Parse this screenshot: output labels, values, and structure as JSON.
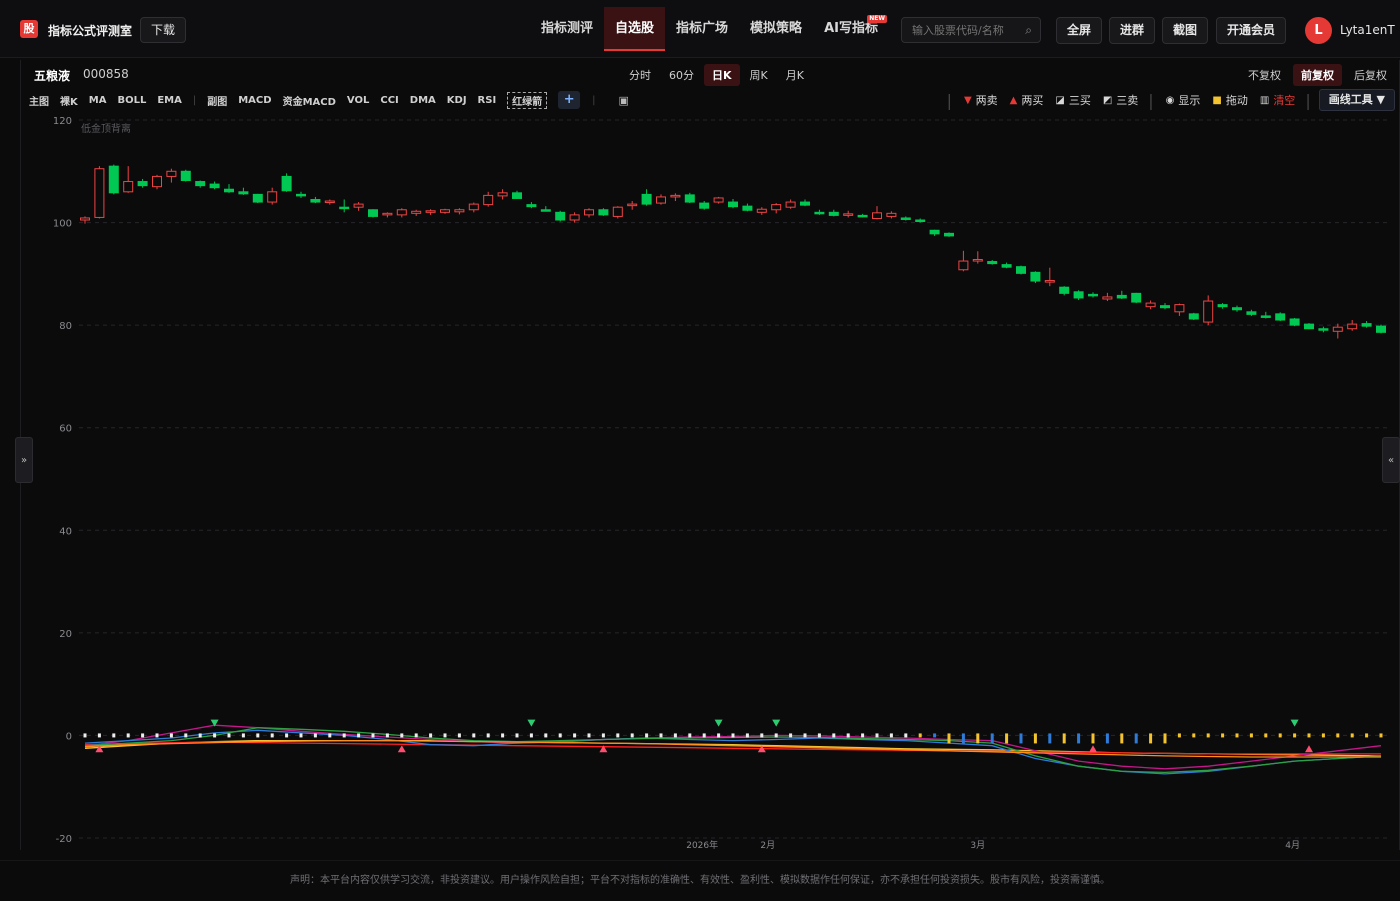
{
  "header": {
    "logo_char": "股",
    "brand": "指标公式评测室",
    "download": "下载",
    "nav": [
      {
        "label": "指标测评",
        "active": false
      },
      {
        "label": "自选股",
        "active": true
      },
      {
        "label": "指标广场",
        "active": false
      },
      {
        "label": "模拟策略",
        "active": false
      },
      {
        "label": "AI写指标",
        "active": false,
        "badge": "NEW"
      }
    ],
    "search_placeholder": "输入股票代码/名称",
    "buttons": [
      "全屏",
      "进群",
      "截图",
      "开通会员"
    ],
    "avatar_letter": "L",
    "username": "Lyta1enT"
  },
  "stock": {
    "name": "五粮液",
    "code": "000858"
  },
  "periods": [
    "分时",
    "60分",
    "日K",
    "周K",
    "月K"
  ],
  "active_period": "日K",
  "adjust": [
    "不复权",
    "前复权",
    "后复权"
  ],
  "active_adjust": "前复权",
  "indicators_main": [
    "主图",
    "裸K",
    "MA",
    "BOLL",
    "EMA"
  ],
  "indicators_sub": [
    "副图",
    "MACD",
    "资金MACD",
    "VOL",
    "CCI",
    "DMA",
    "KDJ",
    "RSI"
  ],
  "indicator_selected": "红绿箭",
  "tools": [
    {
      "icon": "down-triangle",
      "label": "两卖",
      "color": "#e53935"
    },
    {
      "icon": "up-triangle",
      "label": "两买",
      "color": "#e53935"
    },
    {
      "icon": "chart-icon",
      "label": "三买"
    },
    {
      "icon": "chart-icon",
      "label": "三卖"
    },
    {
      "icon": "eye-icon",
      "label": "显示"
    },
    {
      "icon": "lock-icon",
      "label": "拖动"
    },
    {
      "icon": "trash-icon",
      "label": "清空",
      "color": "#e53935"
    }
  ],
  "draw_tools": "画线工具 ▼",
  "expand_left": "»",
  "expand_right": "«",
  "chart_watermark": "低金顶背离",
  "footer": "声明：本平台内容仅供学习交流，非投资建议。用户操作风险自担；平台不对指标的准确性、有效性、盈利性、模拟数据作任何保证，亦不承担任何投资损失。股市有风险，投资需谨慎。",
  "chart_data": {
    "type": "candlestick",
    "y_ticks": [
      120,
      100,
      80,
      60,
      40,
      20,
      0,
      -20
    ],
    "ylim": [
      -20,
      120
    ],
    "x_labels": [
      "2026年",
      "2月",
      "3月",
      "4月"
    ],
    "candles": [
      [
        100.5,
        101.2,
        99.8,
        100.9
      ],
      [
        101,
        111,
        100.8,
        110.5
      ],
      [
        111,
        111.3,
        105.5,
        105.8
      ],
      [
        106,
        111,
        105.8,
        108
      ],
      [
        108,
        108.5,
        106.8,
        107.2
      ],
      [
        107,
        109.3,
        106.5,
        109
      ],
      [
        109,
        110.5,
        107.8,
        110
      ],
      [
        110,
        110.3,
        108,
        108.2
      ],
      [
        108,
        108.2,
        106.8,
        107.2
      ],
      [
        107.5,
        108,
        106.5,
        106.8
      ],
      [
        106.5,
        107.5,
        105.8,
        106
      ],
      [
        106,
        106.8,
        105.4,
        105.6
      ],
      [
        105.5,
        105.6,
        103.8,
        104
      ],
      [
        104,
        106.8,
        103.5,
        106
      ],
      [
        109,
        109.6,
        106,
        106.2
      ],
      [
        105.5,
        106,
        104.8,
        105.2
      ],
      [
        104.5,
        105,
        103.8,
        104
      ],
      [
        104,
        104.5,
        103.5,
        104.2
      ],
      [
        103,
        104.5,
        102,
        102.8
      ],
      [
        103,
        104,
        102.3,
        103.6
      ],
      [
        102.5,
        102.6,
        101,
        101.2
      ],
      [
        101.5,
        102,
        101,
        101.8
      ],
      [
        101.5,
        102.8,
        101,
        102.5
      ],
      [
        101.8,
        102.5,
        101.3,
        102.2
      ],
      [
        102,
        102.6,
        101.5,
        102.3
      ],
      [
        102,
        102.7,
        101.7,
        102.5
      ],
      [
        102.1,
        102.8,
        101.6,
        102.5
      ],
      [
        102.5,
        103.9,
        102,
        103.6
      ],
      [
        103.5,
        106,
        103.1,
        105.3
      ],
      [
        105.2,
        106.5,
        104.5,
        105.8
      ],
      [
        105.8,
        106.2,
        104.6,
        104.7
      ],
      [
        103.5,
        104,
        102.8,
        103.1
      ],
      [
        102.5,
        103.2,
        102.2,
        102.3
      ],
      [
        102,
        102.3,
        100.2,
        100.5
      ],
      [
        100.5,
        102,
        100,
        101.5
      ],
      [
        101.5,
        102.8,
        101,
        102.5
      ],
      [
        102.5,
        102.8,
        101.3,
        101.5
      ],
      [
        101.2,
        103.2,
        100.8,
        103
      ],
      [
        103.3,
        104.2,
        102.5,
        103.6
      ],
      [
        105.5,
        106.5,
        103.3,
        103.6
      ],
      [
        103.8,
        105.5,
        103.5,
        105
      ],
      [
        105,
        105.7,
        104.2,
        105.3
      ],
      [
        105.4,
        105.8,
        103.8,
        104
      ],
      [
        103.8,
        104.2,
        102.5,
        102.8
      ],
      [
        104,
        105,
        103.7,
        104.8
      ],
      [
        104,
        104.6,
        102.8,
        103.1
      ],
      [
        103.2,
        103.7,
        102.2,
        102.4
      ],
      [
        102,
        103,
        101.5,
        102.6
      ],
      [
        102.5,
        103.8,
        101.8,
        103.5
      ],
      [
        103,
        104.5,
        102.7,
        104
      ],
      [
        104,
        104.5,
        103.2,
        103.4
      ],
      [
        102,
        102.5,
        101.5,
        101.8
      ],
      [
        102,
        102.5,
        101.2,
        101.4
      ],
      [
        101.6,
        102.3,
        101,
        101.7
      ],
      [
        101.4,
        101.7,
        101,
        101.2
      ],
      [
        100.8,
        103.2,
        100.6,
        101.9
      ],
      [
        101.2,
        102.2,
        100.8,
        101.8
      ],
      [
        100.9,
        101.2,
        100.4,
        100.6
      ],
      [
        100.5,
        100.8,
        100,
        100.3
      ],
      [
        98.5,
        98.6,
        97.4,
        97.8
      ],
      [
        97.9,
        98.1,
        97.2,
        97.4
      ],
      [
        90.8,
        94.5,
        90.5,
        92.5
      ],
      [
        92.5,
        94.4,
        92,
        92.8
      ],
      [
        92.4,
        92.7,
        91.8,
        92
      ],
      [
        91.8,
        92.2,
        91.1,
        91.3
      ],
      [
        91.4,
        91.6,
        89.9,
        90.1
      ],
      [
        90.3,
        90.5,
        88.2,
        88.6
      ],
      [
        88.4,
        91.2,
        87.6,
        88.7
      ],
      [
        87.4,
        87.6,
        85.8,
        86.2
      ],
      [
        86.5,
        86.8,
        84.9,
        85.3
      ],
      [
        86,
        86.4,
        85.4,
        85.8
      ],
      [
        85.1,
        86.3,
        84.7,
        85.5
      ],
      [
        85.8,
        86.7,
        85.1,
        85.3
      ],
      [
        86.2,
        86.3,
        84.3,
        84.5
      ],
      [
        83.6,
        84.8,
        83.1,
        84.3
      ],
      [
        83.8,
        84.3,
        83.1,
        83.4
      ],
      [
        82.6,
        84.2,
        81.8,
        84
      ],
      [
        82.2,
        82.4,
        81,
        81.2
      ],
      [
        80.6,
        85.8,
        80,
        84.7
      ],
      [
        84,
        84.3,
        83.2,
        83.6
      ],
      [
        83.4,
        83.8,
        82.6,
        83
      ],
      [
        82.6,
        83,
        81.8,
        82.1
      ],
      [
        81.8,
        82.6,
        81.3,
        81.5
      ],
      [
        82.2,
        82.5,
        80.8,
        81
      ],
      [
        81.2,
        81.4,
        79.8,
        80
      ],
      [
        80.2,
        80.4,
        79.2,
        79.3
      ],
      [
        79.3,
        79.7,
        78.6,
        79.2
      ],
      [
        78.8,
        80.3,
        77.4,
        79.6
      ],
      [
        79.3,
        81,
        78.9,
        80.2
      ],
      [
        80.3,
        80.8,
        79.5,
        79.8
      ],
      [
        79.8,
        80.1,
        78.4,
        78.6
      ]
    ],
    "lines": [
      {
        "name": "line-yellow",
        "color": "#f4c430",
        "values": [
          -2.5,
          -2,
          -1.5,
          -1.2,
          -1,
          -1,
          -1,
          -1,
          -1,
          -1.2,
          -1.3,
          -1.4,
          -1.5,
          -1.6,
          -1.7,
          -1.8,
          -2,
          -2.2,
          -2.4,
          -2.6,
          -2.7,
          -2.8,
          -3,
          -3.2,
          -3.4,
          -3.5,
          -3.6,
          -3.7,
          -3.8,
          -3.9,
          -4
        ]
      },
      {
        "name": "line-red",
        "color": "#ff2020",
        "values": [
          -1.8,
          -1.6,
          -1.4,
          -1.3,
          -1.4,
          -1.5,
          -1.6,
          -1.7,
          -1.8,
          -1.9,
          -2,
          -2.1,
          -2.2,
          -2.3,
          -2.4,
          -2.5,
          -2.6,
          -2.7,
          -2.8,
          -2.9,
          -3,
          -3.1,
          -3.2,
          -3.3,
          -3.4,
          -3.5,
          -3.6,
          -3.6,
          -3.6,
          -3.6,
          -3.6
        ]
      },
      {
        "name": "line-magenta",
        "color": "#c2188a",
        "values": [
          -2,
          -1,
          0.5,
          2,
          1.5,
          0.8,
          0.2,
          -0.3,
          -0.8,
          -1.2,
          -1.5,
          -1.3,
          -0.8,
          -0.5,
          -0.3,
          -0.2,
          0,
          -0.1,
          -0.3,
          -0.5,
          -0.8,
          -1,
          -3,
          -5,
          -6,
          -6.5,
          -6,
          -5,
          -4,
          -3,
          -2
        ]
      },
      {
        "name": "line-blue",
        "color": "#2f7bd8",
        "values": [
          -1.5,
          -1,
          -0.5,
          0.5,
          1,
          0.5,
          0,
          -0.8,
          -1.8,
          -2,
          -1.5,
          -1.2,
          -0.8,
          -0.5,
          -0.8,
          -1,
          -0.8,
          -0.5,
          -0.8,
          -1,
          -1.5,
          -2,
          -4.5,
          -6,
          -7,
          -7.5,
          -7,
          -6,
          -5,
          -4.5,
          -4
        ]
      },
      {
        "name": "line-green",
        "color": "#2ea043",
        "values": [
          -2,
          -1.5,
          -1,
          0,
          1.5,
          1.2,
          0.8,
          0.2,
          -0.5,
          -1,
          -1.2,
          -1,
          -0.8,
          -0.6,
          -0.5,
          -0.4,
          -0.3,
          -0.4,
          -0.6,
          -0.8,
          -1,
          -1.5,
          -4,
          -6,
          -7,
          -7.2,
          -6.8,
          -6,
          -5,
          -4.5,
          -4
        ]
      },
      {
        "name": "line-orange",
        "color": "#ff8c1a",
        "values": [
          -2.2,
          -1.8,
          -1.6,
          -1.4,
          -1.2,
          -1.1,
          -1,
          -1,
          -1.1,
          -1.2,
          -1.3,
          -1.4,
          -1.5,
          -1.6,
          -1.8,
          -2,
          -2.2,
          -2.4,
          -2.6,
          -2.8,
          -3,
          -3.2,
          -3.4,
          -3.6,
          -3.8,
          -4,
          -4.1,
          -4.2,
          -4.2,
          -4.2,
          -4.2
        ]
      }
    ]
  }
}
